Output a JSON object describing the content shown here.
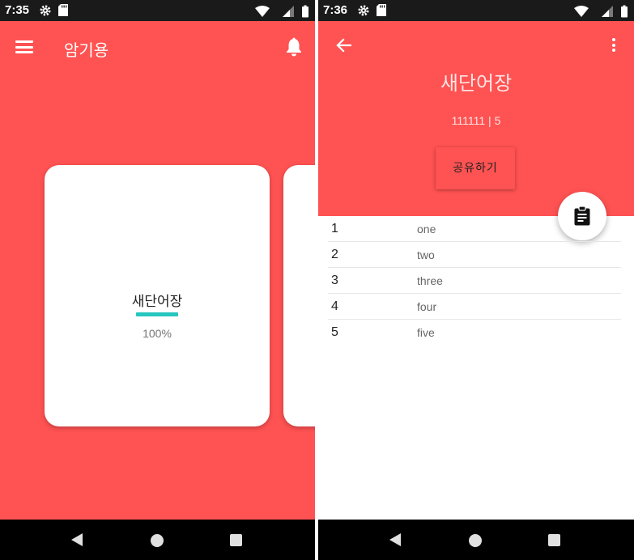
{
  "left_screen": {
    "status": {
      "time": "7:35"
    },
    "app_title": "암기용",
    "cards": [
      {
        "title": "새단어장",
        "progress": "100%",
        "progress_fraction": 1.0
      }
    ]
  },
  "right_screen": {
    "status": {
      "time": "7:36"
    },
    "title": "새단어장",
    "subtitle": "111111 | 5",
    "share_button": "공유하기",
    "words": [
      {
        "num": "1",
        "word": "one"
      },
      {
        "num": "2",
        "word": "two"
      },
      {
        "num": "3",
        "word": "three"
      },
      {
        "num": "4",
        "word": "four"
      },
      {
        "num": "5",
        "word": "five"
      }
    ]
  },
  "icons": {
    "menu": "hamburger-menu-icon",
    "notification": "bell-icon",
    "back": "arrow-back-icon",
    "overflow": "more-vert-icon",
    "fab": "clipboard-icon"
  },
  "colors": {
    "primary": "#FF5252",
    "progress_accent": "#26C6BF",
    "status_bar": "#1a1a1a",
    "nav_bar": "#000000"
  }
}
